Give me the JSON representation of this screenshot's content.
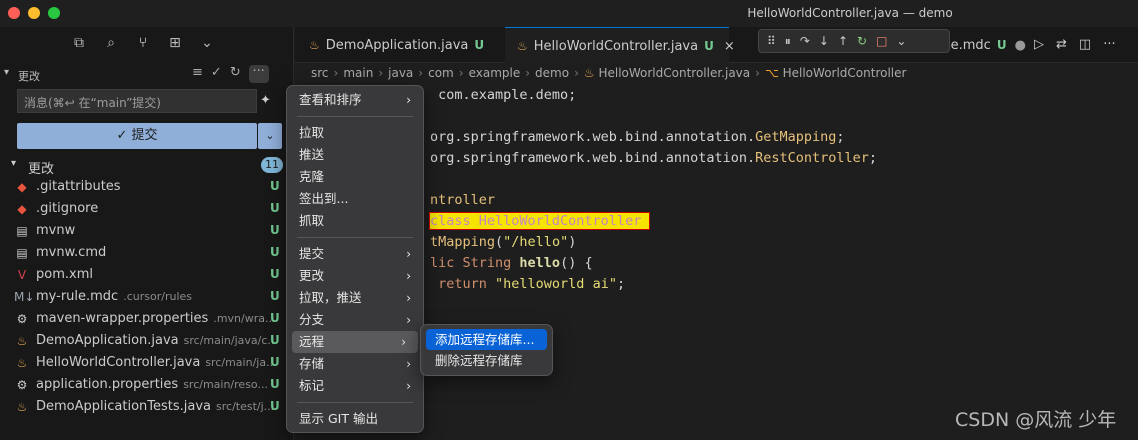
{
  "window": {
    "title": "HelloWorldController.java — demo",
    "traffic_colors": [
      "#ff5f57",
      "#febc2e",
      "#28c840"
    ]
  },
  "activity_icons": [
    "files-icon",
    "search-icon",
    "source-control-icon",
    "extensions-icon",
    "chevron-down-icon"
  ],
  "scm": {
    "section_label": "更改",
    "more_label": "···",
    "message_placeholder": "消息(⌘↩ 在“main”提交)",
    "commit_label": "✓ 提交",
    "changes_label": "更改",
    "changes_count": "11",
    "files": [
      {
        "name": ".gitattributes",
        "path": "",
        "status": "U",
        "icon": "git-icon",
        "color": "#e8543e"
      },
      {
        "name": ".gitignore",
        "path": "",
        "status": "U",
        "icon": "git-icon",
        "color": "#e8543e"
      },
      {
        "name": "mvnw",
        "path": "",
        "status": "U",
        "icon": "file-icon",
        "color": "#cccccc"
      },
      {
        "name": "mvnw.cmd",
        "path": "",
        "status": "U",
        "icon": "file-icon",
        "color": "#cccccc"
      },
      {
        "name": "pom.xml",
        "path": "",
        "status": "U",
        "icon": "maven-icon",
        "color": "#d4404b"
      },
      {
        "name": "my-rule.mdc",
        "path": ".cursor/rules",
        "status": "U",
        "icon": "markdown-icon",
        "color": "#9aa3b0"
      },
      {
        "name": "maven-wrapper.properties",
        "path": ".mvn/wra...",
        "status": "U",
        "icon": "gear-icon",
        "color": "#cccccc"
      },
      {
        "name": "DemoApplication.java",
        "path": "src/main/java/c...",
        "status": "U",
        "icon": "java-icon",
        "color": "#e0a552"
      },
      {
        "name": "HelloWorldController.java",
        "path": "src/main/ja...",
        "status": "U",
        "icon": "java-icon",
        "color": "#e0a552"
      },
      {
        "name": "application.properties",
        "path": "src/main/reso...",
        "status": "U",
        "icon": "gear-icon",
        "color": "#cccccc"
      },
      {
        "name": "DemoApplicationTests.java",
        "path": "src/test/j...",
        "status": "U",
        "icon": "java-icon",
        "color": "#e0a552"
      }
    ]
  },
  "tabs": [
    {
      "label": "DemoApplication.java",
      "status": "U"
    },
    {
      "label": "HelloWorldController.java",
      "status": "U",
      "close": "×"
    },
    {
      "label": "le.mdc",
      "status": "U"
    }
  ],
  "breadcrumb": [
    "src",
    "main",
    "java",
    "com",
    "example",
    "demo",
    "HelloWorldController.java",
    "HelloWorldController"
  ],
  "code_lines": [
    " com.example.demo;",
    "",
    "org.springframework.web.bind.annotation.GetMapping;",
    "org.springframework.web.bind.annotation.RestController;",
    "",
    "ntroller",
    "class HelloWorldController ",
    "tMapping(\"/hello\")",
    "lic String hello() {",
    " return \"helloworld ai\";"
  ],
  "context_menu": {
    "items": [
      {
        "label": "查看和排序",
        "submenu": true
      },
      {
        "separator": true
      },
      {
        "label": "拉取"
      },
      {
        "label": "推送"
      },
      {
        "label": "克隆"
      },
      {
        "label": "签出到..."
      },
      {
        "label": "抓取"
      },
      {
        "separator": true
      },
      {
        "label": "提交",
        "submenu": true
      },
      {
        "label": "更改",
        "submenu": true
      },
      {
        "label": "拉取，推送",
        "submenu": true
      },
      {
        "label": "分支",
        "submenu": true
      },
      {
        "label": "远程",
        "submenu": true,
        "highlighted": true
      },
      {
        "label": "存储",
        "submenu": true
      },
      {
        "label": "标记",
        "submenu": true
      },
      {
        "separator": true
      },
      {
        "label": "显示 GIT 输出"
      }
    ]
  },
  "submenu": {
    "items": [
      {
        "label": "添加远程存储库...",
        "selected": true
      },
      {
        "label": "删除远程存储库"
      }
    ]
  },
  "watermark": "CSDN @风流 少年"
}
